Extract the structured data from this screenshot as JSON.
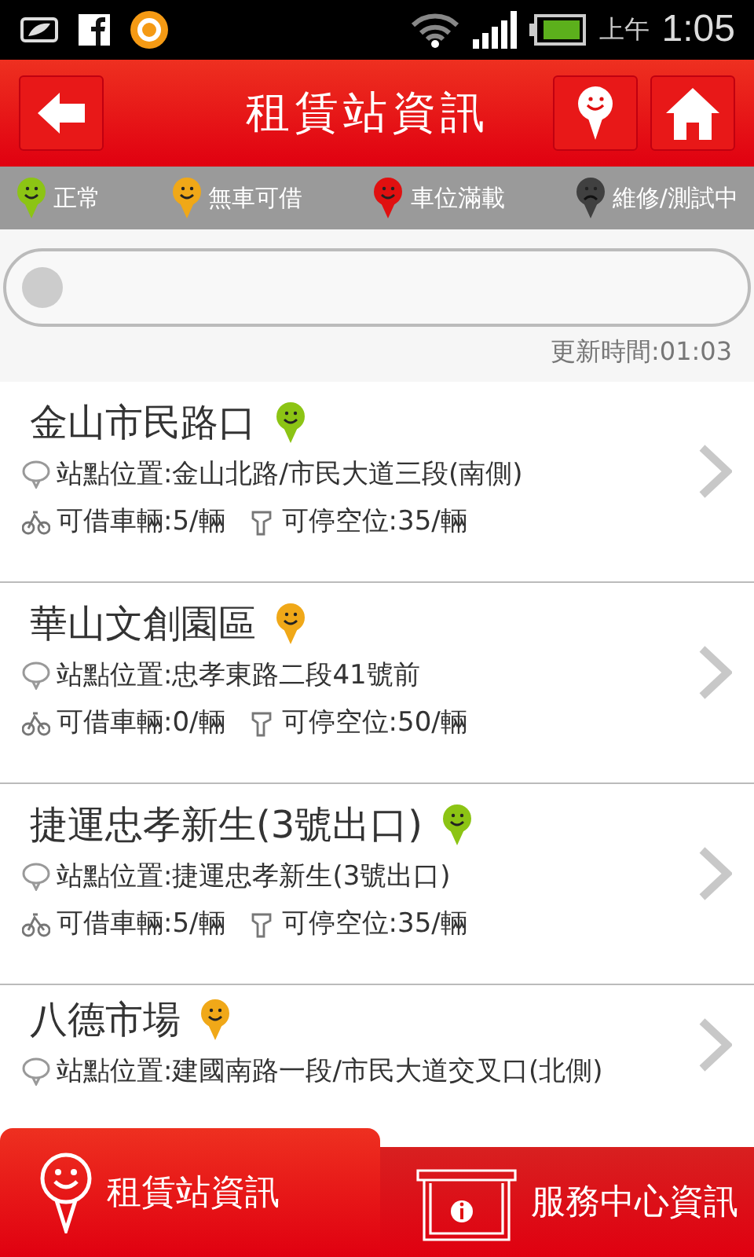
{
  "status_bar": {
    "ampm": "上午",
    "time": "1:05"
  },
  "header": {
    "title": "租賃站資訊"
  },
  "legend": [
    {
      "label": "正常",
      "color": "#8cc414",
      "kind": "happy"
    },
    {
      "label": "無車可借",
      "color": "#f0a818",
      "kind": "happy"
    },
    {
      "label": "車位滿載",
      "color": "#e01010",
      "kind": "happy"
    },
    {
      "label": "維修/測試中",
      "color": "#404040",
      "kind": "sad"
    }
  ],
  "update_time": "更新時間:01:03",
  "stations": [
    {
      "name": "金山市民路口",
      "color": "#8cc414",
      "address": "站點位置:金山北路/市民大道三段(南側)",
      "bikes": "可借車輛:5/輛",
      "spaces": "可停空位:35/輛"
    },
    {
      "name": "華山文創園區",
      "color": "#f0a818",
      "address": "站點位置:忠孝東路二段41號前",
      "bikes": "可借車輛:0/輛",
      "spaces": "可停空位:50/輛"
    },
    {
      "name": "捷運忠孝新生(3號出口)",
      "color": "#8cc414",
      "address": "站點位置:捷運忠孝新生(3號出口)",
      "bikes": "可借車輛:5/輛",
      "spaces": "可停空位:35/輛"
    },
    {
      "name": "八德市場",
      "color": "#f0a818",
      "address": "站點位置:建國南路一段/市民大道交叉口(北側)"
    }
  ],
  "tabs": [
    {
      "label": "租賃站資訊",
      "selected": true,
      "kind": "pin"
    },
    {
      "label": "服務中心資訊",
      "selected": false,
      "kind": "kiosk"
    }
  ]
}
